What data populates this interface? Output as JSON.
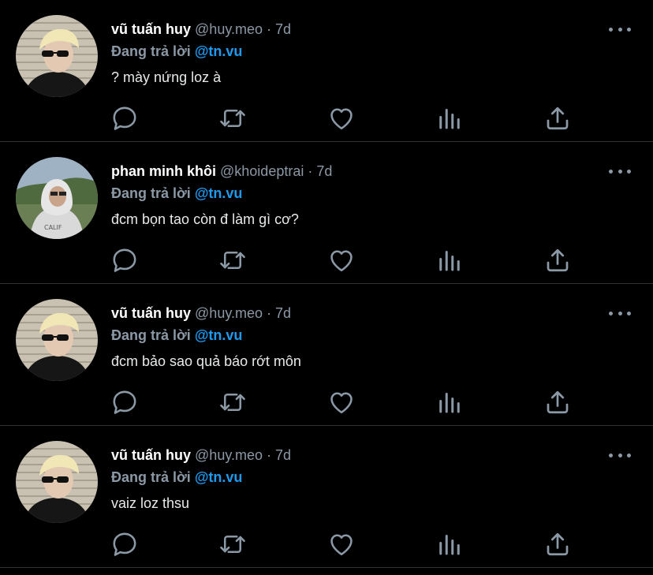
{
  "tweets": [
    {
      "display_name": "vũ tuấn huy",
      "handle": "@huy.meo",
      "separator": "·",
      "time": "7d",
      "reply_prefix": "Đang trả lời",
      "reply_to": "@tn.vu",
      "text": "? mày nứng loz à",
      "avatar": "avatar-huy"
    },
    {
      "display_name": "phan minh khôi",
      "handle": "@khoideptrai",
      "separator": "·",
      "time": "7d",
      "reply_prefix": "Đang trả lời",
      "reply_to": "@tn.vu",
      "text": "đcm bọn tao còn đ làm gì cơ?",
      "avatar": "avatar-khoi"
    },
    {
      "display_name": "vũ tuấn huy",
      "handle": "@huy.meo",
      "separator": "·",
      "time": "7d",
      "reply_prefix": "Đang trả lời",
      "reply_to": "@tn.vu",
      "text": "đcm bảo sao quả báo rớt môn",
      "avatar": "avatar-huy"
    },
    {
      "display_name": "vũ tuấn huy",
      "handle": "@huy.meo",
      "separator": "·",
      "time": "7d",
      "reply_prefix": "Đang trả lời",
      "reply_to": "@tn.vu",
      "text": "vaiz loz thsu",
      "avatar": "avatar-huy"
    }
  ],
  "icons": {
    "reply": "reply-icon",
    "retweet": "retweet-icon",
    "like": "heart-icon",
    "views": "views-icon",
    "share": "share-icon",
    "more": "more-icon"
  },
  "colors": {
    "background": "#000000",
    "name": "#ffffff",
    "muted": "#8b98a5",
    "mention": "#1d9bf0",
    "divider": "#2f3336"
  }
}
